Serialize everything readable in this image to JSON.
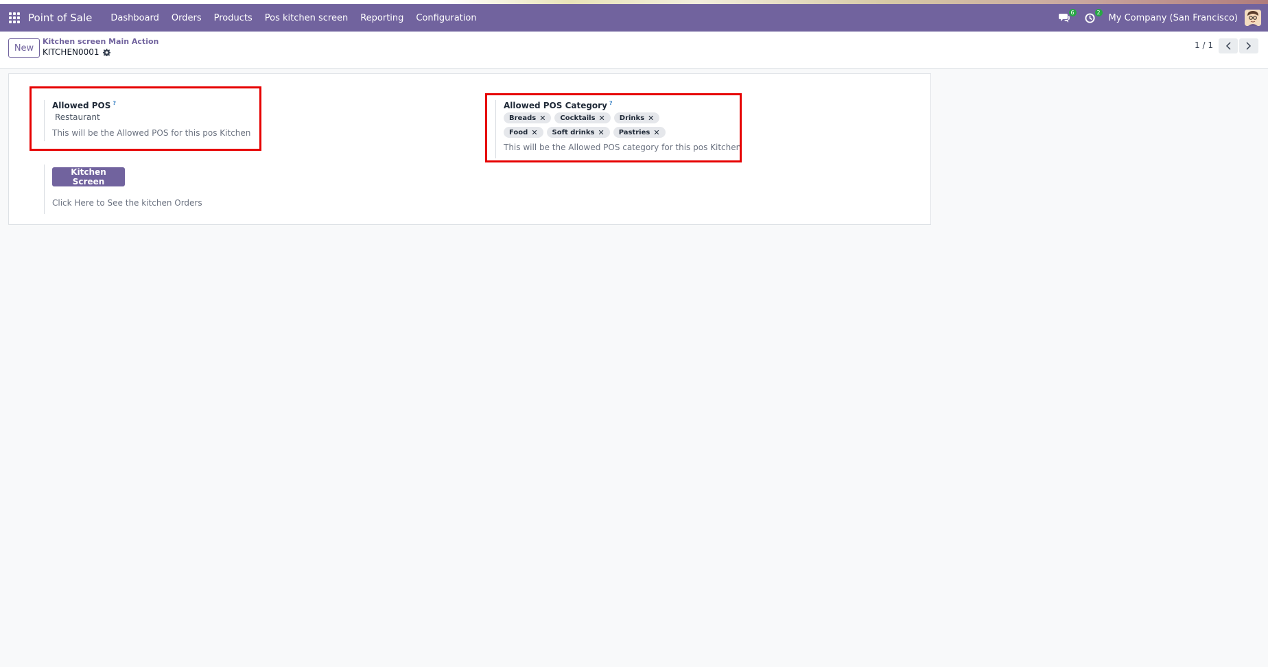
{
  "navbar": {
    "brand": "Point of Sale",
    "menu": [
      {
        "label": "Dashboard"
      },
      {
        "label": "Orders"
      },
      {
        "label": "Products"
      },
      {
        "label": "Pos kitchen screen"
      },
      {
        "label": "Reporting"
      },
      {
        "label": "Configuration"
      }
    ],
    "messages_count": "6",
    "activities_count": "2",
    "company": "My Company (San Francisco)",
    "bg_color": "#71639e"
  },
  "control_panel": {
    "new_label": "New",
    "breadcrumb": "Kitchen screen Main Action",
    "record_name": "KITCHEN0001",
    "pager": "1 / 1"
  },
  "form": {
    "allowed_pos": {
      "label": "Allowed POS",
      "tooltip_mark": "?",
      "value": "Restaurant",
      "help": "This will be the Allowed POS for this pos Kitchen"
    },
    "allowed_pos_category": {
      "label": "Allowed POS Category",
      "tooltip_mark": "?",
      "tags": [
        "Breads",
        "Cocktails",
        "Drinks",
        "Food",
        "Soft drinks",
        "Pastries"
      ],
      "help": "This will be the Allowed POS category for this pos Kitchen"
    },
    "kitchen_button": {
      "label": "Kitchen Screen",
      "help": "Click Here to See the kitchen Orders"
    }
  },
  "icons": {
    "apps": "apps-grid-icon",
    "messages": "chat-bubble-icon",
    "activities": "clock-icon",
    "settings": "gear-icon",
    "prev": "chevron-left-icon",
    "next": "chevron-right-icon",
    "tag_remove": "close-icon"
  },
  "highlight_color": "#e60000"
}
